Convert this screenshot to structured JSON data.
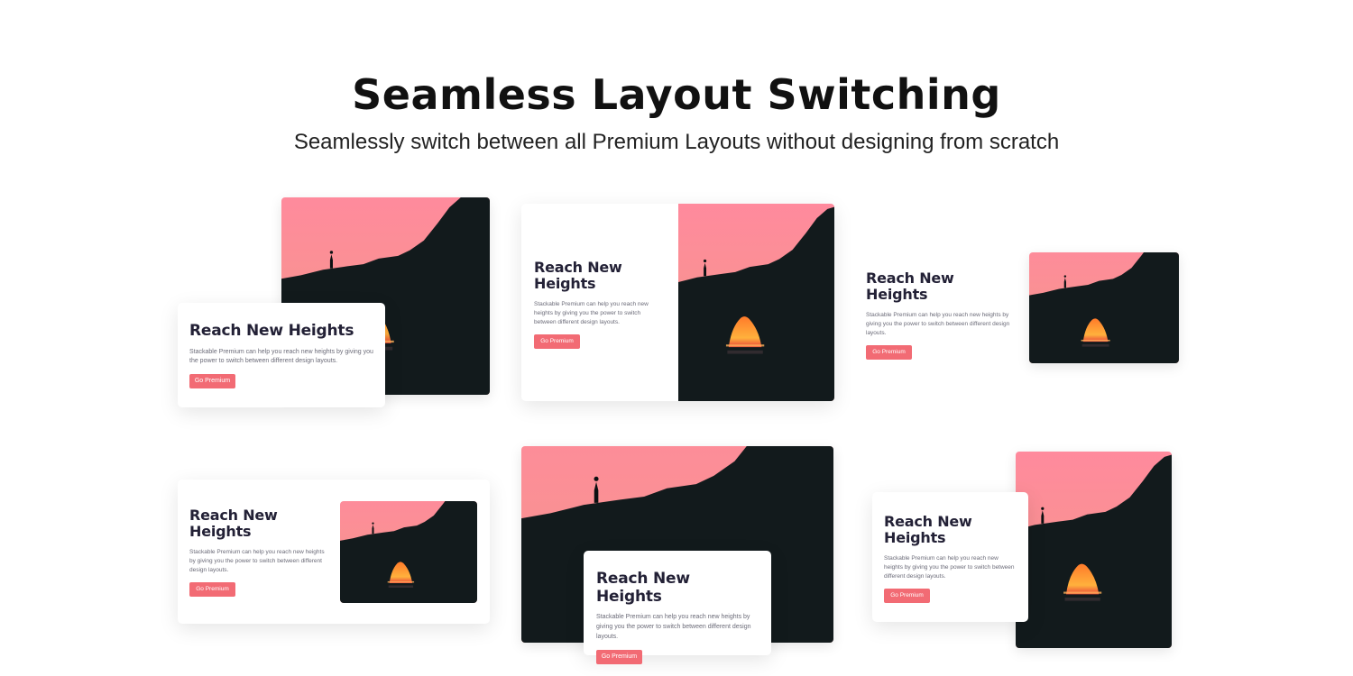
{
  "header": {
    "title": "Seamless Layout Switching",
    "subtitle": "Seamlessly switch between all Premium Layouts without designing from scratch"
  },
  "layouts": [
    {
      "title": "Reach New Heights",
      "body": "Stackable Premium can help you reach new heights by giving you the power to switch between different design layouts.",
      "button": "Go Premium"
    },
    {
      "title": "Reach New Heights",
      "body": "Stackable Premium can help you reach new heights by giving you the power to switch between different design layouts.",
      "button": "Go Premium"
    },
    {
      "title": "Reach New Heights",
      "body": "Stackable Premium can help you reach new heights by giving you the power to switch between different design layouts.",
      "button": "Go Premium"
    },
    {
      "title": "Reach New Heights",
      "body": "Stackable Premium can help you reach new heights by giving you the power to switch between different design layouts.",
      "button": "Go Premium"
    },
    {
      "title": "Reach New Heights",
      "body": "Stackable Premium can help you reach new heights by giving you the power to switch between different design layouts.",
      "button": "Go Premium"
    },
    {
      "title": "Reach New Heights",
      "body": "Stackable Premium can help you reach new heights by giving you the power to switch between different design layouts.",
      "button": "Go Premium"
    }
  ],
  "colors": {
    "accent": "#f26b74",
    "sky_top": "#ff8f9e",
    "sky_bottom": "#f49a86",
    "rock": "#121a1c",
    "sunset_glow": "#ff8a1e"
  },
  "image_icon": "sunset-cliff-arch-photo"
}
